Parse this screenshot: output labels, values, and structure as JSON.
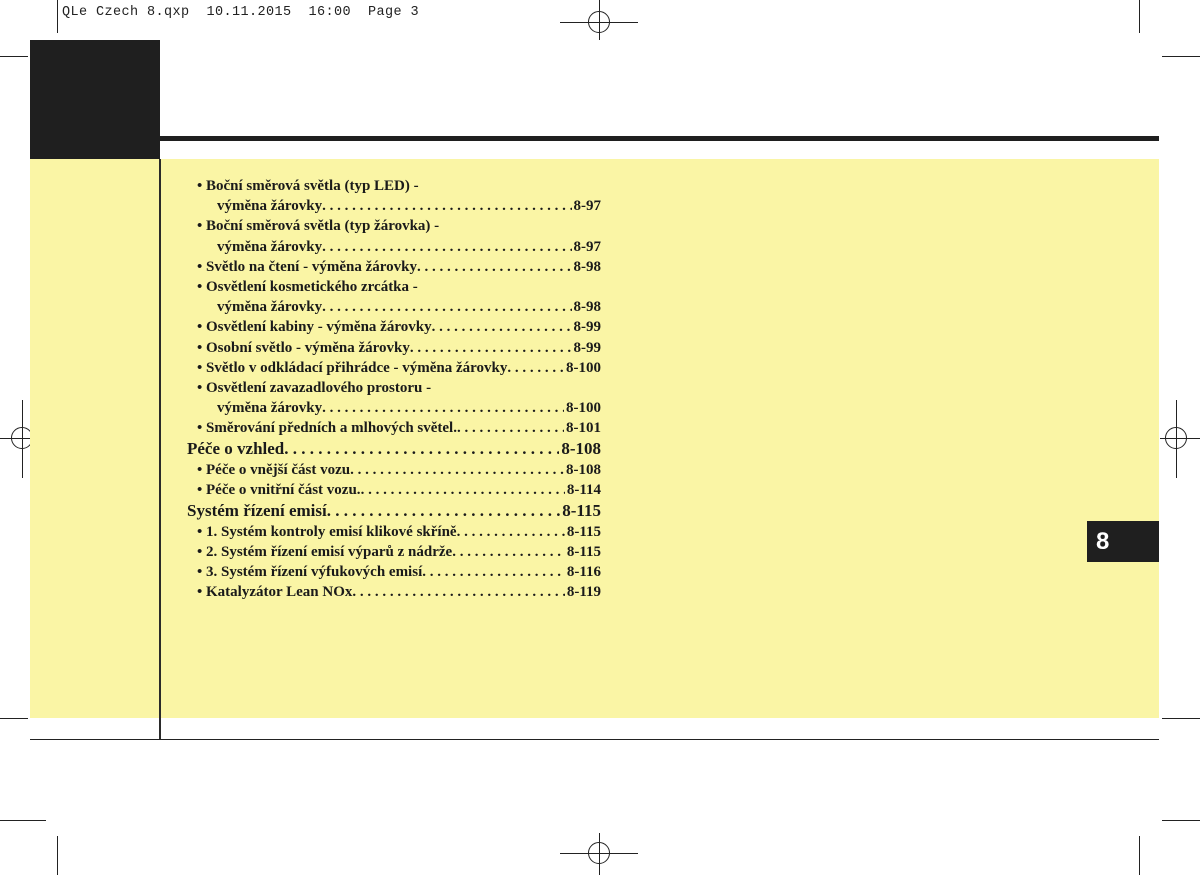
{
  "print_slug": "QLe Czech 8.qxp  10.11.2015  16:00  Page 3",
  "chapter_tab": "8",
  "toc": [
    {
      "type": "head",
      "text": "• Boční směrová světla (typ LED) -"
    },
    {
      "type": "cont",
      "text": "výměna žárovky",
      "page": "8-97"
    },
    {
      "type": "head",
      "text": "• Boční směrová světla (typ žárovka) -"
    },
    {
      "type": "cont",
      "text": "výměna žárovky",
      "page": "8-97"
    },
    {
      "type": "sub",
      "text": "• Světlo na čtení - výměna žárovky",
      "page": "8-98"
    },
    {
      "type": "head",
      "text": "• Osvětlení kosmetického zrcátka -"
    },
    {
      "type": "cont",
      "text": "výměna žárovky",
      "page": "8-98"
    },
    {
      "type": "sub",
      "text": "• Osvětlení kabiny - výměna žárovky",
      "page": "8-99"
    },
    {
      "type": "sub",
      "text": "• Osobní světlo - výměna žárovky",
      "page": "8-99"
    },
    {
      "type": "sub",
      "text": "• Světlo v odkládací přihrádce - výměna žárovky",
      "page": "8-100"
    },
    {
      "type": "head",
      "text": "• Osvětlení zavazadlového prostoru -"
    },
    {
      "type": "cont",
      "text": "výměna žárovky",
      "page": "8-100"
    },
    {
      "type": "sub",
      "text": "• Směrování předních a mlhových světel.",
      "page": "8-101"
    },
    {
      "type": "main",
      "text": "Péče o vzhled",
      "page": "8-108"
    },
    {
      "type": "sub",
      "text": "• Péče o vnější část vozu",
      "page": "8-108"
    },
    {
      "type": "sub",
      "text": "• Péče o vnitřní část vozu.",
      "page": "8-114"
    },
    {
      "type": "main",
      "text": "Systém řízení emisí",
      "page": "8-115"
    },
    {
      "type": "sub",
      "text": "• 1. Systém kontroly emisí klikové skříně",
      "page": "8-115"
    },
    {
      "type": "sub",
      "text": "• 2. Systém řízení emisí výparů z nádrže",
      "page": "8-115"
    },
    {
      "type": "sub",
      "text": "• 3. Systém řízení výfukových emisí",
      "page": "8-116"
    },
    {
      "type": "sub",
      "text": "• Katalyzátor Lean NOx",
      "page": "8-119"
    }
  ]
}
